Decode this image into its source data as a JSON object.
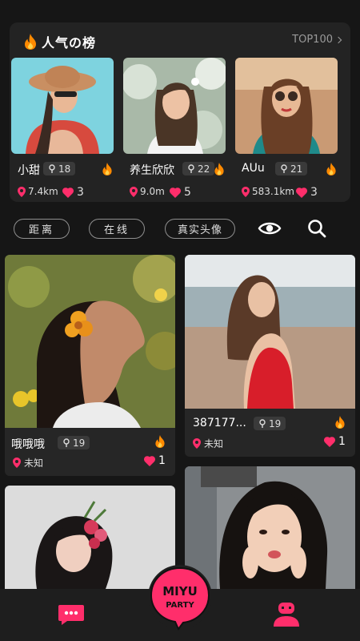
{
  "board": {
    "title": "人气の榜",
    "top_label": "TOP100",
    "users": [
      {
        "name": "小甜",
        "level": "18",
        "distance": "7.4km",
        "likes": "3"
      },
      {
        "name": "养生欣欣",
        "level": "22",
        "distance": "9.0m",
        "likes": "5"
      },
      {
        "name": "AUu",
        "level": "21",
        "distance": "583.1km",
        "likes": "3"
      }
    ]
  },
  "filters": {
    "distance": "距离",
    "online": "在线",
    "real_avatar": "真实头像"
  },
  "feed": [
    {
      "name": "哦哦哦",
      "level": "19",
      "location": "未知",
      "likes": "1"
    },
    {
      "name": "387177...",
      "level": "19",
      "location": "未知",
      "likes": "1"
    }
  ],
  "brand": {
    "line1": "MIYU",
    "line2": "PARTY"
  },
  "colors": {
    "accent": "#ff2e6b",
    "flame": "#ff8a00",
    "background": "#161616",
    "card": "#262626"
  }
}
